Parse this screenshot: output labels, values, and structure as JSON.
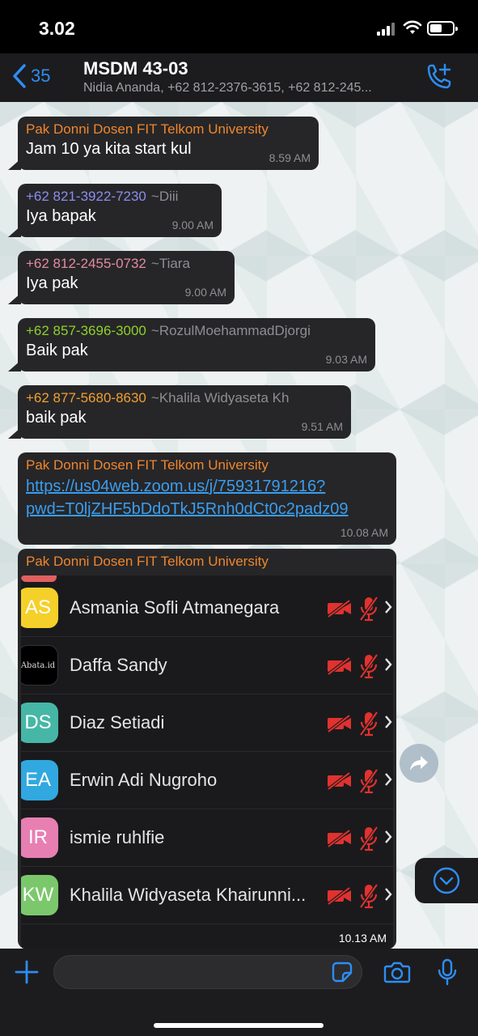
{
  "status_bar": {
    "time": "3.02"
  },
  "header": {
    "back_count": "35",
    "title": "MSDM 43-03",
    "subtitle": "Nidia Ananda, +62 812-2376-3615, +62 812-245..."
  },
  "messages": [
    {
      "sender": "Pak Donni Dosen FIT Telkom University",
      "alias": "",
      "sender_color": "#f0862d",
      "text": "Jam 10 ya kita start kul",
      "time": "8.59 AM"
    },
    {
      "sender": "+62 821-3922-7230",
      "alias": "~Diii",
      "sender_color": "#8b8cf0",
      "text": "Iya bapak",
      "time": "9.00 AM"
    },
    {
      "sender": "+62 812-2455-0732",
      "alias": "~Tiara",
      "sender_color": "#e58aa0",
      "text": "Iya pak",
      "time": "9.00 AM"
    },
    {
      "sender": "+62 857-3696-3000",
      "alias": "~RozulMoehammadDjorgi",
      "sender_color": "#8ed12b",
      "text": "Baik pak",
      "time": "9.03 AM"
    },
    {
      "sender": "+62 877-5680-8630",
      "alias": "~Khalila Widyaseta Kh",
      "sender_color": "#f0a030",
      "text": "baik pak",
      "time": "9.51 AM"
    }
  ],
  "link_message": {
    "sender": "Pak Donni Dosen FIT Telkom University",
    "sender_color": "#f0862d",
    "link_line1": "https://us04web.zoom.us/j/75931791216?",
    "link_line2": "pwd=T0ljZHF5bDdoTkJ5Rnh0dCt0c2padz09",
    "time": "10.08 AM"
  },
  "image_message": {
    "sender": "Pak Donni Dosen FIT Telkom University",
    "sender_color": "#f0862d",
    "time": "10.13 AM",
    "participants": [
      {
        "initials": "AS",
        "name": "Asmania Sofli Atmanegara",
        "color": "#f5d02a"
      },
      {
        "initials": "Abata.id",
        "name": "Daffa Sandy",
        "color": "#000000"
      },
      {
        "initials": "DS",
        "name": "Diaz Setiadi",
        "color": "#46b7a6"
      },
      {
        "initials": "EA",
        "name": "Erwin Adi Nugroho",
        "color": "#31a8e0"
      },
      {
        "initials": "IR",
        "name": "ismie ruhlfie",
        "color": "#e77fb3"
      },
      {
        "initials": "KW",
        "name": "Khalila Widyaseta Khairunni...",
        "color": "#7bc86c"
      }
    ]
  },
  "input": {
    "placeholder": ""
  },
  "colors": {
    "accent": "#2e8df5",
    "bubble": "#262628",
    "muted_red": "#e0322f"
  }
}
